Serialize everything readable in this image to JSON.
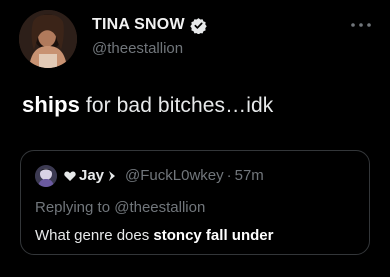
{
  "tweet": {
    "author": {
      "name": "TINA SNOW",
      "handle": "@theestallion",
      "verified": true
    },
    "text_bold": "ships",
    "text_rest": "for bad bitches…idk",
    "more_icon": "more-horizontal-icon"
  },
  "quote": {
    "author": {
      "name": "Jay",
      "handle": "@FuckL0wkey",
      "separator": "·",
      "time": "57m",
      "badge_icon": "sparkle-icon",
      "prefix_icon": "heart-flag-icon"
    },
    "replying_to": "Replying to @theestallion",
    "text_plain": "What genre does",
    "text_bold": "stoncy fall under"
  },
  "colors": {
    "background": "#000000",
    "text": "#e7e9ea",
    "muted": "#71767b",
    "border": "#333639",
    "verified_badge": "#e7e9ea"
  }
}
